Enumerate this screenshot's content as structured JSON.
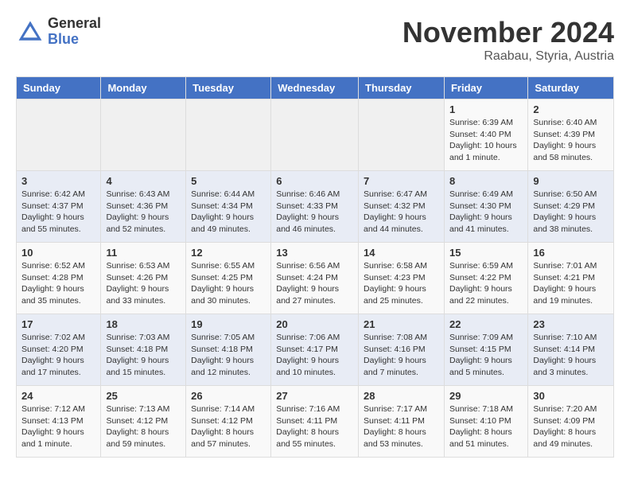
{
  "logo": {
    "general": "General",
    "blue": "Blue"
  },
  "header": {
    "month": "November 2024",
    "location": "Raabau, Styria, Austria"
  },
  "weekdays": [
    "Sunday",
    "Monday",
    "Tuesday",
    "Wednesday",
    "Thursday",
    "Friday",
    "Saturday"
  ],
  "weeks": [
    [
      {
        "day": "",
        "info": ""
      },
      {
        "day": "",
        "info": ""
      },
      {
        "day": "",
        "info": ""
      },
      {
        "day": "",
        "info": ""
      },
      {
        "day": "",
        "info": ""
      },
      {
        "day": "1",
        "info": "Sunrise: 6:39 AM\nSunset: 4:40 PM\nDaylight: 10 hours and 1 minute."
      },
      {
        "day": "2",
        "info": "Sunrise: 6:40 AM\nSunset: 4:39 PM\nDaylight: 9 hours and 58 minutes."
      }
    ],
    [
      {
        "day": "3",
        "info": "Sunrise: 6:42 AM\nSunset: 4:37 PM\nDaylight: 9 hours and 55 minutes."
      },
      {
        "day": "4",
        "info": "Sunrise: 6:43 AM\nSunset: 4:36 PM\nDaylight: 9 hours and 52 minutes."
      },
      {
        "day": "5",
        "info": "Sunrise: 6:44 AM\nSunset: 4:34 PM\nDaylight: 9 hours and 49 minutes."
      },
      {
        "day": "6",
        "info": "Sunrise: 6:46 AM\nSunset: 4:33 PM\nDaylight: 9 hours and 46 minutes."
      },
      {
        "day": "7",
        "info": "Sunrise: 6:47 AM\nSunset: 4:32 PM\nDaylight: 9 hours and 44 minutes."
      },
      {
        "day": "8",
        "info": "Sunrise: 6:49 AM\nSunset: 4:30 PM\nDaylight: 9 hours and 41 minutes."
      },
      {
        "day": "9",
        "info": "Sunrise: 6:50 AM\nSunset: 4:29 PM\nDaylight: 9 hours and 38 minutes."
      }
    ],
    [
      {
        "day": "10",
        "info": "Sunrise: 6:52 AM\nSunset: 4:28 PM\nDaylight: 9 hours and 35 minutes."
      },
      {
        "day": "11",
        "info": "Sunrise: 6:53 AM\nSunset: 4:26 PM\nDaylight: 9 hours and 33 minutes."
      },
      {
        "day": "12",
        "info": "Sunrise: 6:55 AM\nSunset: 4:25 PM\nDaylight: 9 hours and 30 minutes."
      },
      {
        "day": "13",
        "info": "Sunrise: 6:56 AM\nSunset: 4:24 PM\nDaylight: 9 hours and 27 minutes."
      },
      {
        "day": "14",
        "info": "Sunrise: 6:58 AM\nSunset: 4:23 PM\nDaylight: 9 hours and 25 minutes."
      },
      {
        "day": "15",
        "info": "Sunrise: 6:59 AM\nSunset: 4:22 PM\nDaylight: 9 hours and 22 minutes."
      },
      {
        "day": "16",
        "info": "Sunrise: 7:01 AM\nSunset: 4:21 PM\nDaylight: 9 hours and 19 minutes."
      }
    ],
    [
      {
        "day": "17",
        "info": "Sunrise: 7:02 AM\nSunset: 4:20 PM\nDaylight: 9 hours and 17 minutes."
      },
      {
        "day": "18",
        "info": "Sunrise: 7:03 AM\nSunset: 4:18 PM\nDaylight: 9 hours and 15 minutes."
      },
      {
        "day": "19",
        "info": "Sunrise: 7:05 AM\nSunset: 4:18 PM\nDaylight: 9 hours and 12 minutes."
      },
      {
        "day": "20",
        "info": "Sunrise: 7:06 AM\nSunset: 4:17 PM\nDaylight: 9 hours and 10 minutes."
      },
      {
        "day": "21",
        "info": "Sunrise: 7:08 AM\nSunset: 4:16 PM\nDaylight: 9 hours and 7 minutes."
      },
      {
        "day": "22",
        "info": "Sunrise: 7:09 AM\nSunset: 4:15 PM\nDaylight: 9 hours and 5 minutes."
      },
      {
        "day": "23",
        "info": "Sunrise: 7:10 AM\nSunset: 4:14 PM\nDaylight: 9 hours and 3 minutes."
      }
    ],
    [
      {
        "day": "24",
        "info": "Sunrise: 7:12 AM\nSunset: 4:13 PM\nDaylight: 9 hours and 1 minute."
      },
      {
        "day": "25",
        "info": "Sunrise: 7:13 AM\nSunset: 4:12 PM\nDaylight: 8 hours and 59 minutes."
      },
      {
        "day": "26",
        "info": "Sunrise: 7:14 AM\nSunset: 4:12 PM\nDaylight: 8 hours and 57 minutes."
      },
      {
        "day": "27",
        "info": "Sunrise: 7:16 AM\nSunset: 4:11 PM\nDaylight: 8 hours and 55 minutes."
      },
      {
        "day": "28",
        "info": "Sunrise: 7:17 AM\nSunset: 4:11 PM\nDaylight: 8 hours and 53 minutes."
      },
      {
        "day": "29",
        "info": "Sunrise: 7:18 AM\nSunset: 4:10 PM\nDaylight: 8 hours and 51 minutes."
      },
      {
        "day": "30",
        "info": "Sunrise: 7:20 AM\nSunset: 4:09 PM\nDaylight: 8 hours and 49 minutes."
      }
    ]
  ]
}
